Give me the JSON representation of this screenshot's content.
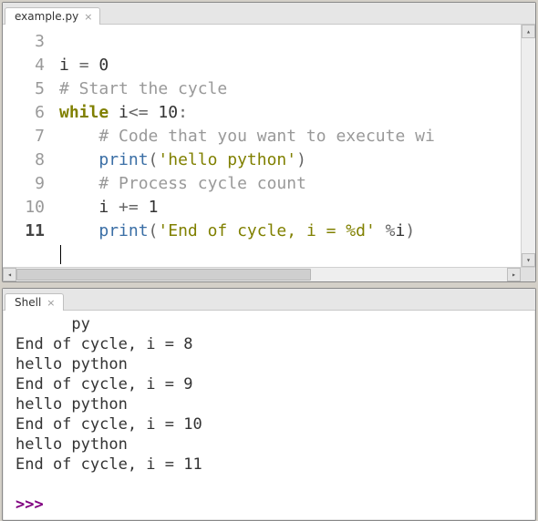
{
  "editor": {
    "tab_label": "example.py",
    "line_start": 3,
    "line_end": 11,
    "current_line": 11,
    "code": {
      "l3": {
        "var": "i",
        "eq": "=",
        "val": "0"
      },
      "l4": {
        "comment": "# Start the cycle"
      },
      "l5": {
        "kw": "while",
        "cond": " i",
        "op": "<=",
        "rest": " 10",
        "colon": ":"
      },
      "l6": {
        "indent": "    ",
        "comment": "# Code that you want to execute wi"
      },
      "l7": {
        "indent": "    ",
        "fn": "print",
        "open": "(",
        "str": "'hello python'",
        "close": ")"
      },
      "l8": {
        "indent": "    ",
        "comment": "# Process cycle count"
      },
      "l9": {
        "indent": "    ",
        "var": "i",
        "op": " += ",
        "val": "1"
      },
      "l10": {
        "indent": "    ",
        "fn": "print",
        "open": "(",
        "str": "'End of cycle, i = %d'",
        "mid": " ",
        "op": "%",
        "var": "i",
        "close": ")"
      }
    }
  },
  "shell": {
    "tab_label": "Shell",
    "partial_top": "      py",
    "lines": [
      "End of cycle, i = 8",
      "hello python",
      "End of cycle, i = 9",
      "hello python",
      "End of cycle, i = 10",
      "hello python",
      "End of cycle, i = 11"
    ],
    "prompt": ">>> "
  }
}
